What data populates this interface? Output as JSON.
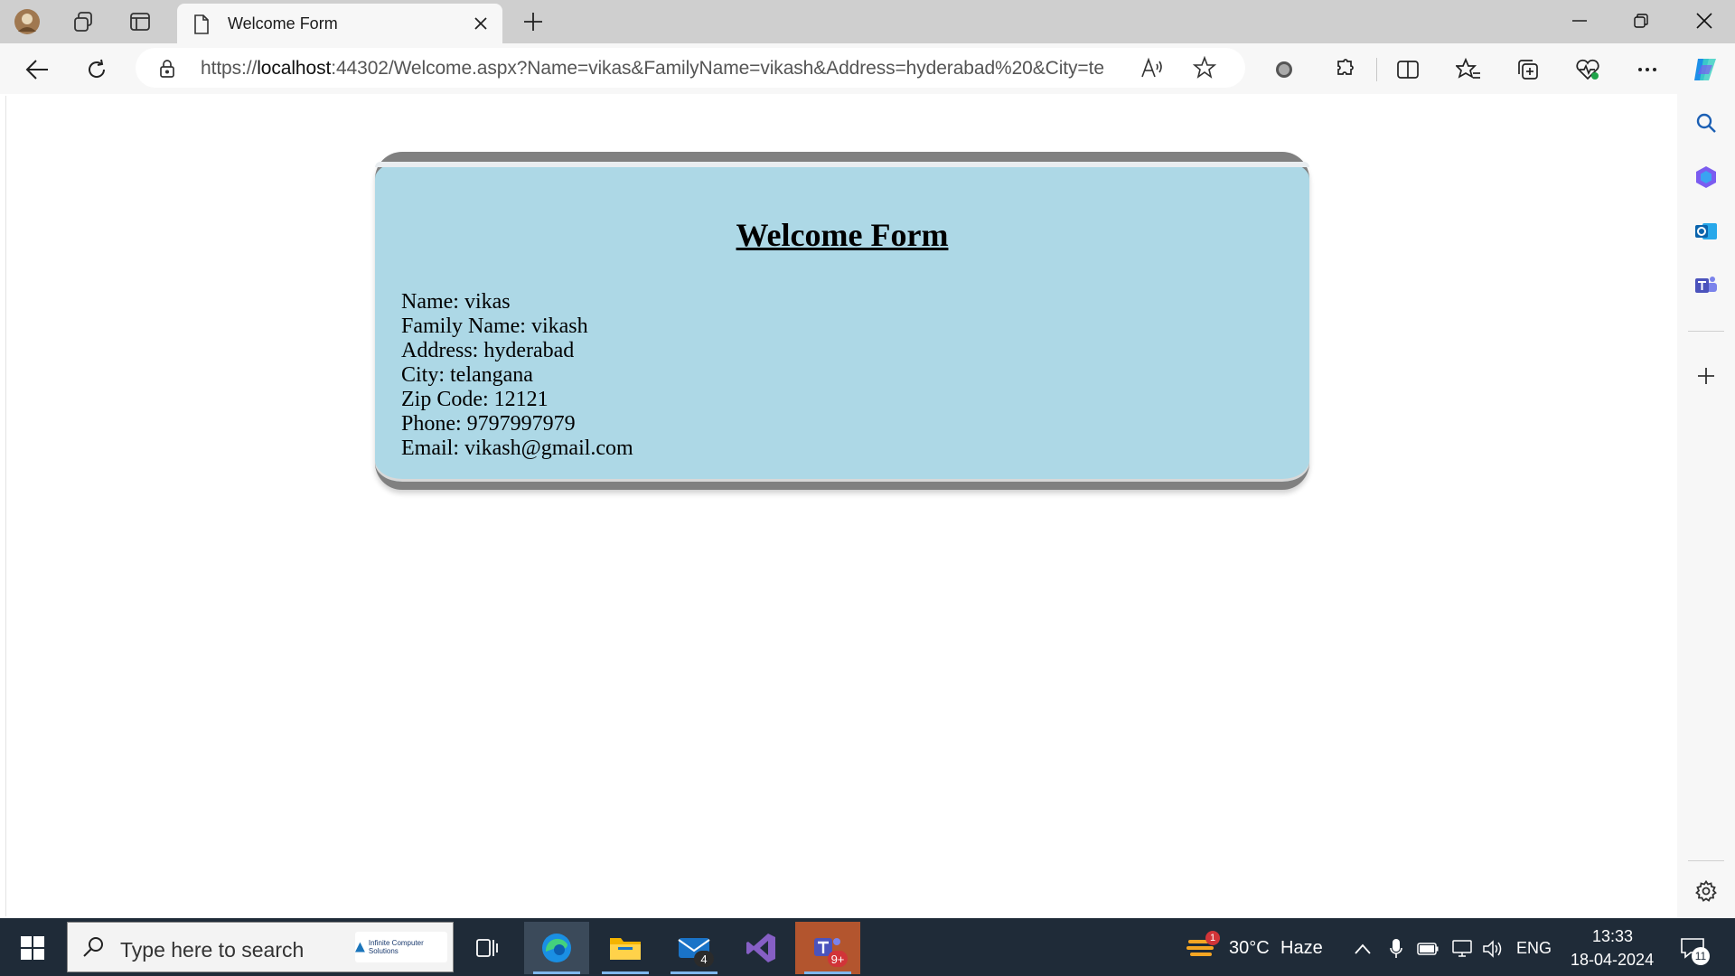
{
  "browser": {
    "tab": {
      "title": "Welcome Form"
    },
    "address": {
      "prefix": "https://",
      "host": "localhost",
      "rest": ":44302/Welcome.aspx?Name=vikas&FamilyName=vikash&Address=hyderabad%20&City=te..."
    }
  },
  "page": {
    "heading": "Welcome Form",
    "fields": [
      "Name: vikas",
      "Family Name: vikash",
      "Address: hyderabad",
      "City: telangana",
      "Zip Code: 12121",
      "Phone: 9797997979",
      "Email: vikash@gmail.com"
    ]
  },
  "taskbar": {
    "search_placeholder": "Type here to search",
    "search_logo_text": "Infinite Computer Solutions",
    "mail_badge": "4",
    "teams_badge": "9+",
    "weather": {
      "badge": "1",
      "temp": "30°C",
      "condition": "Haze"
    },
    "language": "ENG",
    "time": "13:33",
    "date": "18-04-2024",
    "notification_count": "11"
  },
  "colors": {
    "card_bg": "#ADD8E6",
    "card_border": "#808080",
    "taskbar_bg": "#1f2b38",
    "edge_accent": "#0c8ce9"
  }
}
